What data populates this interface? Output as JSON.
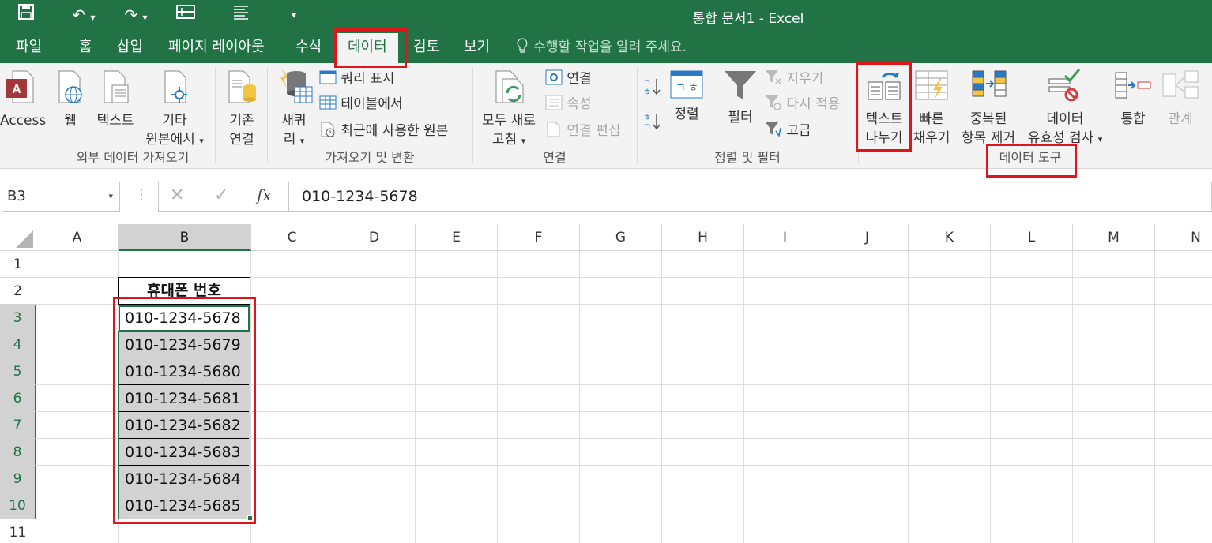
{
  "window": {
    "title": "통합 문서1 - Excel"
  },
  "tabs": [
    "파일",
    "홈",
    "삽입",
    "페이지 레이아웃",
    "수식",
    "데이터",
    "검토",
    "보기"
  ],
  "tell_me": "수행할 작업을 알려 주세요.",
  "ribbon": {
    "external": {
      "access": "Access",
      "web": "웹",
      "text": "텍스트",
      "other1": "기타",
      "other2": "원본에서",
      "existing1": "기존",
      "existing2": "연결",
      "group": "외부 데이터 가져오기"
    },
    "transform": {
      "newq1": "새쿼",
      "newq2": "리",
      "show_queries": "쿼리 표시",
      "from_table": "테이블에서",
      "recent": "최근에 사용한 원본",
      "group": "가져오기 및 변환"
    },
    "connections": {
      "refresh1": "모두 새로",
      "refresh2": "고침",
      "connections": "연결",
      "properties": "속성",
      "edit_links": "연결 편집",
      "group": "연결"
    },
    "sort": {
      "sort": "정렬",
      "filter": "필터",
      "clear": "지우기",
      "reapply": "다시 적용",
      "advanced": "고급",
      "group": "정렬 및 필터"
    },
    "tools": {
      "t2c1": "텍스트",
      "t2c2": "나누기",
      "flash1": "빠른",
      "flash2": "채우기",
      "dup1": "중복된",
      "dup2": "항목 제거",
      "valid1": "데이터",
      "valid2": "유효성 검사",
      "consol": "통합",
      "rel": "관계",
      "group": "데이터 도구"
    }
  },
  "formula_bar": {
    "name_box": "B3",
    "value": "010-1234-5678"
  },
  "columns": [
    "A",
    "B",
    "C",
    "D",
    "E",
    "F",
    "G",
    "H",
    "I",
    "J",
    "K",
    "L",
    "M",
    "N"
  ],
  "rows": [
    "1",
    "2",
    "3",
    "4",
    "5",
    "6",
    "7",
    "8",
    "9",
    "10",
    "11"
  ],
  "cells": {
    "header": "휴대폰 번호",
    "phones": [
      "010-1234-5678",
      "010-1234-5679",
      "010-1234-5680",
      "010-1234-5681",
      "010-1234-5682",
      "010-1234-5683",
      "010-1234-5684",
      "010-1234-5685"
    ]
  }
}
